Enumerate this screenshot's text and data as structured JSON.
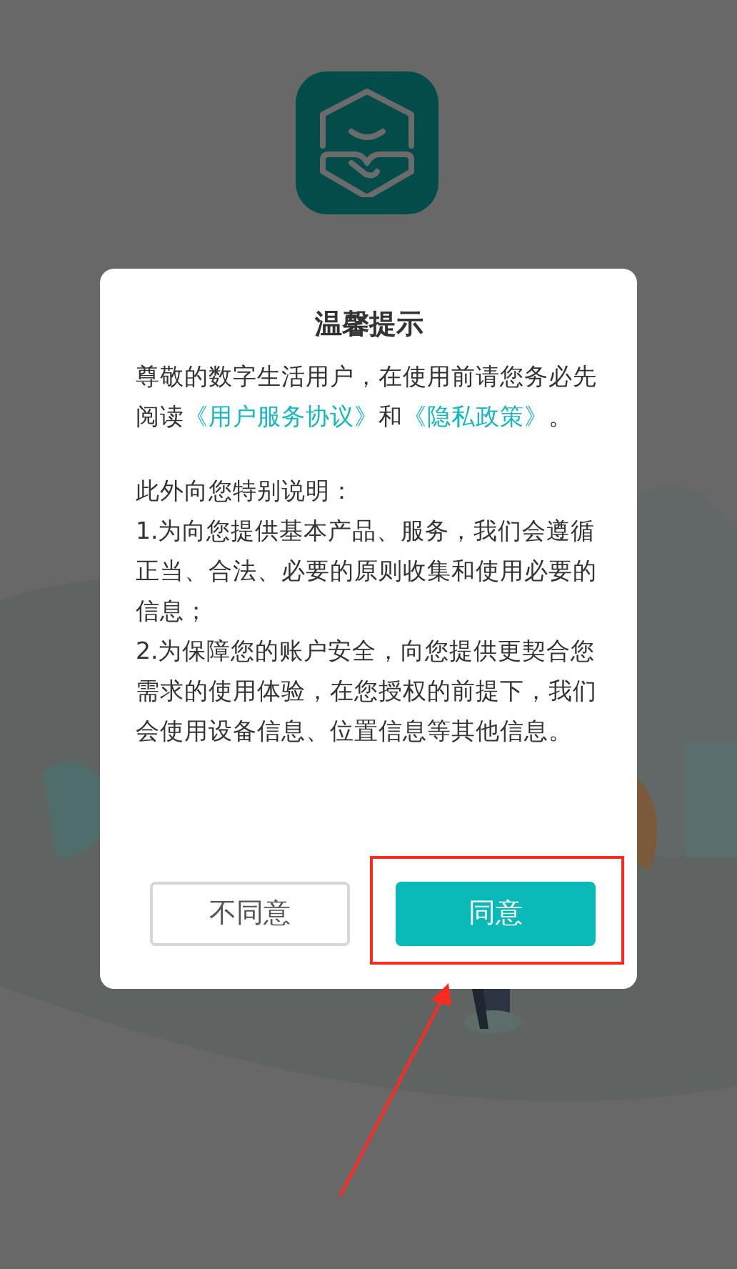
{
  "dialog": {
    "title": "温馨提示",
    "intro": [
      {
        "kind": "text",
        "text": "尊敬的数字生活用户，在使用前请您务必先阅读"
      },
      {
        "kind": "link",
        "text": "《用户服务协议》"
      },
      {
        "kind": "text",
        "text": "和"
      },
      {
        "kind": "link",
        "text": "《隐私政策》"
      },
      {
        "kind": "text",
        "text": "。"
      }
    ],
    "notes": [
      "此外向您特别说明：",
      "1.为向您提供基本产品、服务，我们会遵循正当、合法、必要的原则收集和使用必要的信息；",
      "2.为保障您的账户安全，向您提供更契合您需求的使用体验，在您授权的前提下，我们会使用设备信息、位置信息等其他信息。"
    ],
    "buttons": [
      {
        "label": "不同意",
        "kind": "secondary",
        "highlighted": false
      },
      {
        "label": "同意",
        "kind": "primary",
        "highlighted": true
      }
    ]
  }
}
